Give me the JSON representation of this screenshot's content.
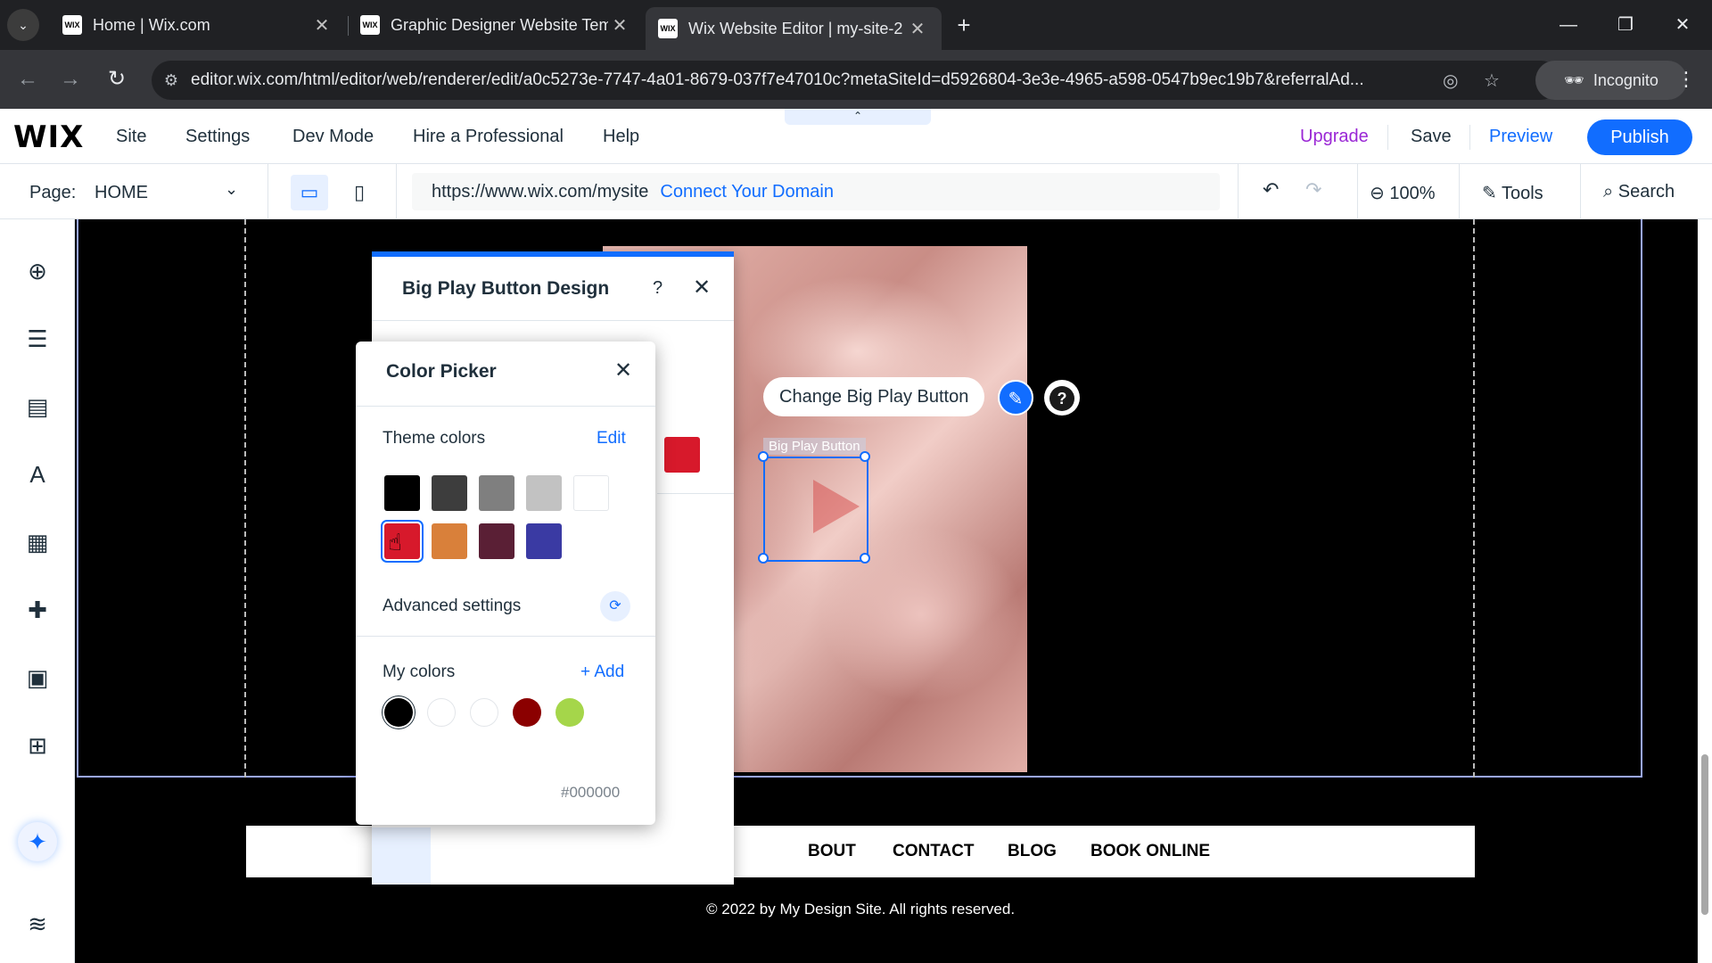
{
  "browser": {
    "tabs": [
      {
        "title": "Home | Wix.com",
        "favicon": "WIX"
      },
      {
        "title": "Graphic Designer Website Temp",
        "favicon": "WIX"
      },
      {
        "title": "Wix Website Editor | my-site-2",
        "favicon": "WIX"
      }
    ],
    "new_tab": "+",
    "url": "editor.wix.com/html/editor/web/renderer/edit/a0c5273e-7747-4a01-8679-037f7e47010c?metaSiteId=d5926804-3e3e-4965-a598-0547b9ec19b7&referralAd...",
    "incognito_label": "Incognito"
  },
  "wix_topbar": {
    "logo": "WIX",
    "menu": [
      "Site",
      "Settings",
      "Dev Mode",
      "Hire a Professional",
      "Help"
    ],
    "upgrade": "Upgrade",
    "save": "Save",
    "preview": "Preview",
    "publish": "Publish"
  },
  "pagebar": {
    "page_label": "Page:",
    "page_value": "HOME",
    "site_url": "https://www.wix.com/mysite",
    "connect_domain": "Connect Your Domain",
    "zoom": "100%",
    "tools": "Tools",
    "search": "Search"
  },
  "canvas": {
    "change_button": "Change Big Play Button",
    "element_label": "Big Play Button",
    "footer_nav": [
      "BOUT",
      "CONTACT",
      "BLOG",
      "BOOK ONLINE"
    ],
    "copyright": "© 2022 by My Design Site. All rights reserved."
  },
  "bpb_panel": {
    "title": "Big Play Button Design",
    "help": "?",
    "close": "✕",
    "current_color": "#d7192b"
  },
  "color_picker": {
    "title": "Color Picker",
    "close": "✕",
    "theme_label": "Theme colors",
    "theme_edit": "Edit",
    "theme_colors": [
      "#000000",
      "#3d3d3d",
      "#7f7f7f",
      "#c2c2c2",
      "#ffffff",
      "#d7192b",
      "#d9803a",
      "#5a1f35",
      "#3a3aa3"
    ],
    "advanced_label": "Advanced settings",
    "my_colors_label": "My colors",
    "my_colors_add": "+ Add",
    "my_colors": [
      "#000000",
      "#ffffff",
      "#ffffff",
      "#8b0000",
      "#a5d64a"
    ],
    "hex": "#000000"
  }
}
